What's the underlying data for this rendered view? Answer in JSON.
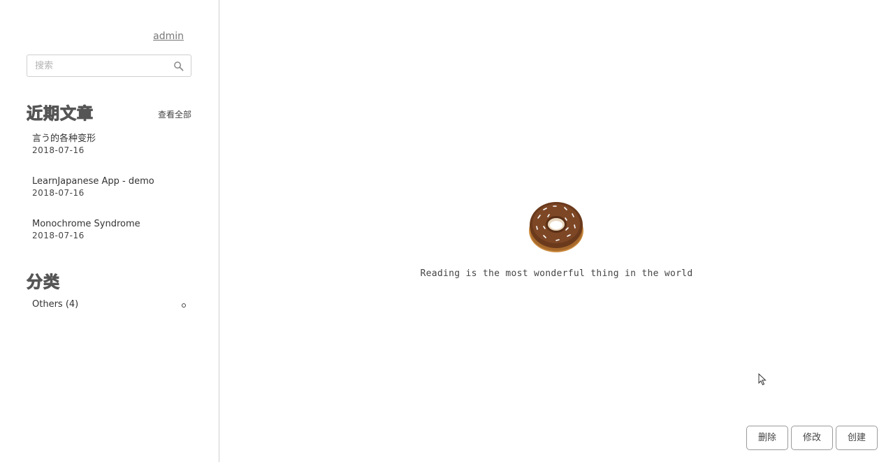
{
  "sidebar": {
    "user_link": "admin",
    "search": {
      "placeholder": "搜索",
      "value": "",
      "icon": "search-icon"
    },
    "recent": {
      "title": "近期文章",
      "view_all": "查看全部",
      "posts": [
        {
          "title": "言う的各种变形",
          "date": "2018-07-16"
        },
        {
          "title": "LearnJapanese App - demo",
          "date": "2018-07-16"
        },
        {
          "title": "Monochrome Syndrome",
          "date": "2018-07-16"
        }
      ]
    },
    "categories": {
      "title": "分类",
      "items": [
        {
          "label": "Others (4)"
        }
      ]
    }
  },
  "main": {
    "image": "donut",
    "quote": "Reading is the most wonderful thing in the world",
    "buttons": {
      "delete": "删除",
      "edit": "修改",
      "create": "创建"
    }
  },
  "colors": {
    "border": "#cfcfcf",
    "text": "#333333",
    "muted": "#777777",
    "donut_chocolate": "#6b3a1c",
    "donut_dough": "#c98a3f"
  }
}
